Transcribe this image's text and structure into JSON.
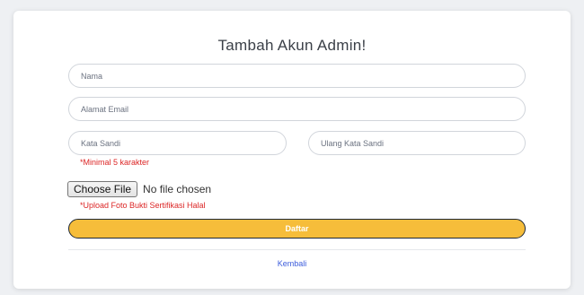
{
  "form": {
    "title": "Tambah Akun Admin!",
    "name_placeholder": "Nama",
    "email_placeholder": "Alamat Email",
    "password_placeholder": "Kata Sandi",
    "repeat_password_placeholder": "Ulang Kata Sandi",
    "password_hint": "*Minimal 5 karakter",
    "file_button_label": "Choose File",
    "file_status": "No file chosen",
    "file_hint": "*Upload Foto Bukti Sertifikasi Halal",
    "submit_label": "Daftar",
    "back_link": "Kembali"
  },
  "colors": {
    "submit_bg": "#f6bd3a",
    "hint": "#dc2626",
    "link": "#3b5bdb"
  }
}
